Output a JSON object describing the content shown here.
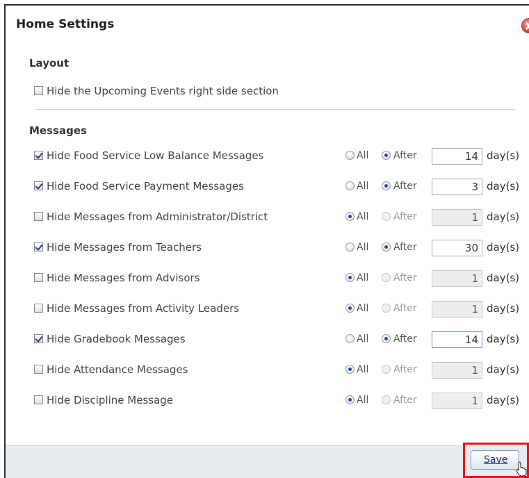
{
  "dialog": {
    "title": "Home Settings",
    "close_icon": "close-icon"
  },
  "layout": {
    "heading": "Layout",
    "items": [
      {
        "label": "Hide the Upcoming Events right side section",
        "checked": false
      }
    ]
  },
  "messages": {
    "heading": "Messages",
    "all_label": "All",
    "after_label": "After",
    "unit_label": "day(s)",
    "rows": [
      {
        "label": "Hide Food Service Low Balance Messages",
        "checked": true,
        "mode": "after",
        "days": "14",
        "enabled": true
      },
      {
        "label": "Hide Food Service Payment Messages",
        "checked": true,
        "mode": "after",
        "days": "3",
        "enabled": true
      },
      {
        "label": "Hide Messages from Administrator/District",
        "checked": false,
        "mode": "all",
        "days": "1",
        "enabled": false
      },
      {
        "label": "Hide Messages from Teachers",
        "checked": true,
        "mode": "after",
        "days": "30",
        "enabled": true
      },
      {
        "label": "Hide Messages from Advisors",
        "checked": false,
        "mode": "all",
        "days": "1",
        "enabled": false
      },
      {
        "label": "Hide Messages from Activity Leaders",
        "checked": false,
        "mode": "all",
        "days": "1",
        "enabled": false
      },
      {
        "label": "Hide Gradebook Messages",
        "checked": true,
        "mode": "after",
        "days": "14",
        "enabled": true,
        "focused": true
      },
      {
        "label": "Hide Attendance Messages",
        "checked": false,
        "mode": "all",
        "days": "1",
        "enabled": false
      },
      {
        "label": "Hide Discipline Message",
        "checked": false,
        "mode": "all",
        "days": "1",
        "enabled": false
      }
    ]
  },
  "footer": {
    "save_label": "Save",
    "highlight_color": "#e0161c"
  }
}
